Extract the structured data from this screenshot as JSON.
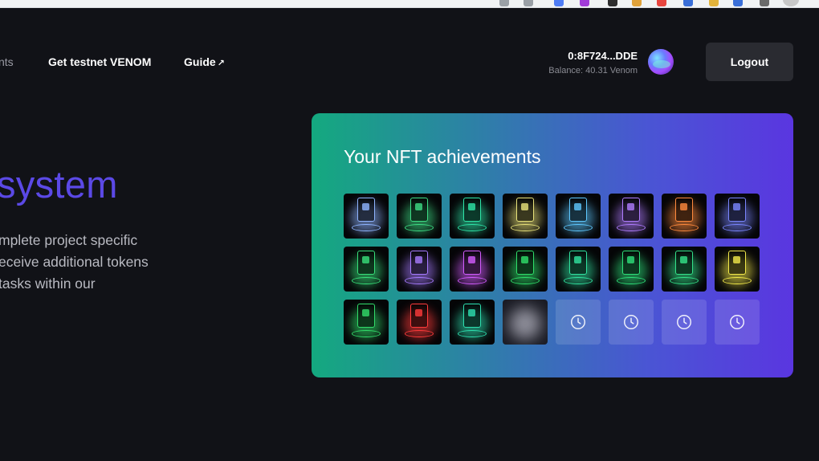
{
  "nav": {
    "partial_link": "nts",
    "testnet_link": "Get testnet VENOM",
    "guide_link": "Guide",
    "guide_arrow": "↗"
  },
  "wallet": {
    "address": "0:8F724...DDE",
    "balance": "Balance: 40.31 Venom"
  },
  "logout_label": "Logout",
  "hero": {
    "title_fragment": "system",
    "description_lines": [
      "mplete project specific",
      "eceive additional tokens",
      "tasks within our"
    ]
  },
  "nft": {
    "title": "Your NFT achievements",
    "tiles": [
      {
        "state": "earned",
        "color": "#8fb4ff",
        "icon": "nft-badge"
      },
      {
        "state": "earned",
        "color": "#3ddc84",
        "icon": "nft-badge"
      },
      {
        "state": "earned",
        "color": "#2ee6a8",
        "icon": "nft-badge"
      },
      {
        "state": "earned",
        "color": "#e8e27a",
        "icon": "nft-badge"
      },
      {
        "state": "earned",
        "color": "#5ec8ff",
        "icon": "nft-badge"
      },
      {
        "state": "earned",
        "color": "#b07cff",
        "icon": "nft-badge"
      },
      {
        "state": "earned",
        "color": "#ff8a3d",
        "icon": "nft-badge"
      },
      {
        "state": "earned",
        "color": "#7a86ff",
        "icon": "nft-badge"
      },
      {
        "state": "earned",
        "color": "#38e07a",
        "icon": "nft-badge"
      },
      {
        "state": "earned",
        "color": "#a77bff",
        "icon": "nft-badge"
      },
      {
        "state": "earned",
        "color": "#d35cff",
        "icon": "nft-badge"
      },
      {
        "state": "earned",
        "color": "#2fe06a",
        "icon": "nft-badge"
      },
      {
        "state": "earned",
        "color": "#31e3a0",
        "icon": "nft-badge"
      },
      {
        "state": "earned",
        "color": "#2ee07a",
        "icon": "nft-badge"
      },
      {
        "state": "earned",
        "color": "#34e38a",
        "icon": "nft-badge"
      },
      {
        "state": "earned",
        "color": "#f3ea4a",
        "icon": "nft-badge"
      },
      {
        "state": "earned",
        "color": "#32dc6a",
        "icon": "nft-badge"
      },
      {
        "state": "earned",
        "color": "#ff3b3b",
        "icon": "nft-badge"
      },
      {
        "state": "earned",
        "color": "#2ee0b0",
        "icon": "nft-badge"
      },
      {
        "state": "blurred",
        "color": "#9a9aa6",
        "icon": "nft-badge-hidden"
      },
      {
        "state": "pending",
        "color": "#ffffff",
        "icon": "clock-icon"
      },
      {
        "state": "pending",
        "color": "#ffffff",
        "icon": "clock-icon"
      },
      {
        "state": "pending",
        "color": "#ffffff",
        "icon": "clock-icon"
      },
      {
        "state": "pending",
        "color": "#ffffff",
        "icon": "clock-icon"
      }
    ]
  },
  "colors": {
    "background": "#111217",
    "accent": "#5b49e6",
    "card_gradient_start": "#14a97f",
    "card_gradient_end": "#5a36e0"
  }
}
